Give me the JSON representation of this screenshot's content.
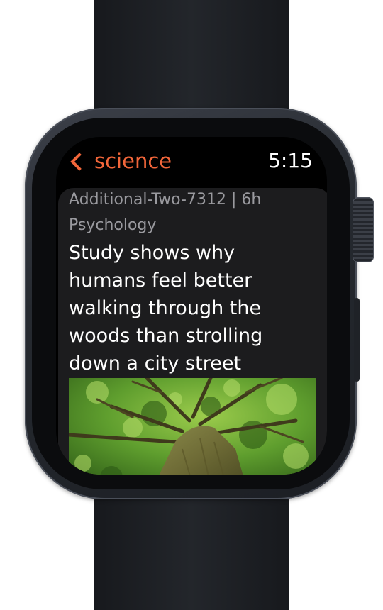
{
  "nav": {
    "back_label": "science",
    "time": "5:15"
  },
  "post": {
    "meta": "Additional-Two-7312 | 6h",
    "flair": "Psychology",
    "title": "Study shows why humans feel better walking through the woods than strolling down a city street"
  },
  "colors": {
    "accent": "#f2663a",
    "screen_background": "#000000",
    "card_background": "#1c1c1e",
    "secondary_text": "#9a9a9f",
    "primary_text": "#ffffff"
  },
  "icons": {
    "back": "chevron-left-icon"
  }
}
